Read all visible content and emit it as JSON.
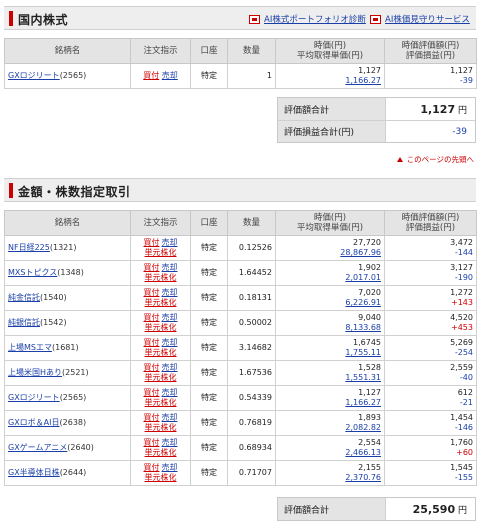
{
  "domestic": {
    "title": "国内株式",
    "links": [
      "AI株式ポートフォリオ診断",
      "AI株価見守りサービス"
    ],
    "headers": [
      "銘柄名",
      "注文指示",
      "口座",
      "数量",
      "時価(円)",
      "平均取得単価(円)",
      "時価評価額(円)",
      "評価損益(円)"
    ],
    "rows": [
      {
        "name": "GXロジリート",
        "code": "(2565)",
        "buy": "買付",
        "sell": "売却",
        "account": "特定",
        "qty": "1",
        "price": "1,127",
        "avg": "1,166.27",
        "value": "1,127",
        "pl": "-39"
      }
    ],
    "summary": {
      "total_label": "評価額合計",
      "total_value": "1,127",
      "unit": "円",
      "pl_label": "評価損益合計(円)",
      "pl_value": "-39"
    },
    "page_top": "このページの先頭へ"
  },
  "fund": {
    "title": "金額・株数指定取引",
    "headers": [
      "銘柄名",
      "注文指示",
      "口座",
      "数量",
      "時価(円)",
      "平均取得単価(円)",
      "時価評価額(円)",
      "評価損益(円)"
    ],
    "order_buy": "買付",
    "order_sell": "売却",
    "order_unit": "単元株化",
    "rows": [
      {
        "name": "NF日経225",
        "code": "(1321)",
        "account": "特定",
        "qty": "0.12526",
        "price": "27,720",
        "avg": "28,867.96",
        "value": "3,472",
        "pl": "-144"
      },
      {
        "name": "MXSトピクス",
        "code": "(1348)",
        "account": "特定",
        "qty": "1.64452",
        "price": "1,902",
        "avg": "2,017.01",
        "value": "3,127",
        "pl": "-190"
      },
      {
        "name": "純金信託",
        "code": "(1540)",
        "account": "特定",
        "qty": "0.18131",
        "price": "7,020",
        "avg": "6,226.91",
        "value": "1,272",
        "pl": "+143"
      },
      {
        "name": "純銀信託",
        "code": "(1542)",
        "account": "特定",
        "qty": "0.50002",
        "price": "9,040",
        "avg": "8,133.68",
        "value": "4,520",
        "pl": "+453"
      },
      {
        "name": "上場MSエマ",
        "code": "(1681)",
        "account": "特定",
        "qty": "3.14682",
        "price": "1,6745",
        "avg": "1,755.11",
        "value": "5,269",
        "pl": "-254"
      },
      {
        "name": "上場米国Hあり",
        "code": "(2521)",
        "account": "特定",
        "qty": "1.67536",
        "price": "1,528",
        "avg": "1,551.31",
        "value": "2,559",
        "pl": "-40"
      },
      {
        "name": "GXロジリート",
        "code": "(2565)",
        "account": "特定",
        "qty": "0.54339",
        "price": "1,127",
        "avg": "1,166.27",
        "value": "612",
        "pl": "-21"
      },
      {
        "name": "GXロボ＆AI日",
        "code": "(2638)",
        "account": "特定",
        "qty": "0.76819",
        "price": "1,893",
        "avg": "2,082.82",
        "value": "1,454",
        "pl": "-146"
      },
      {
        "name": "GXゲームアニメ",
        "code": "(2640)",
        "account": "特定",
        "qty": "0.68934",
        "price": "2,554",
        "avg": "2,466.13",
        "value": "1,760",
        "pl": "+60"
      },
      {
        "name": "GX半導体日株",
        "code": "(2644)",
        "account": "特定",
        "qty": "0.71707",
        "price": "2,155",
        "avg": "2,370.76",
        "value": "1,545",
        "pl": "-155"
      }
    ],
    "summary": {
      "total_label": "評価額合計",
      "total_value": "25,590",
      "unit": "円"
    }
  },
  "colors": {
    "accent": "#cc0000",
    "link": "#1a3fa8",
    "header_bg": "#e4e4e4"
  }
}
